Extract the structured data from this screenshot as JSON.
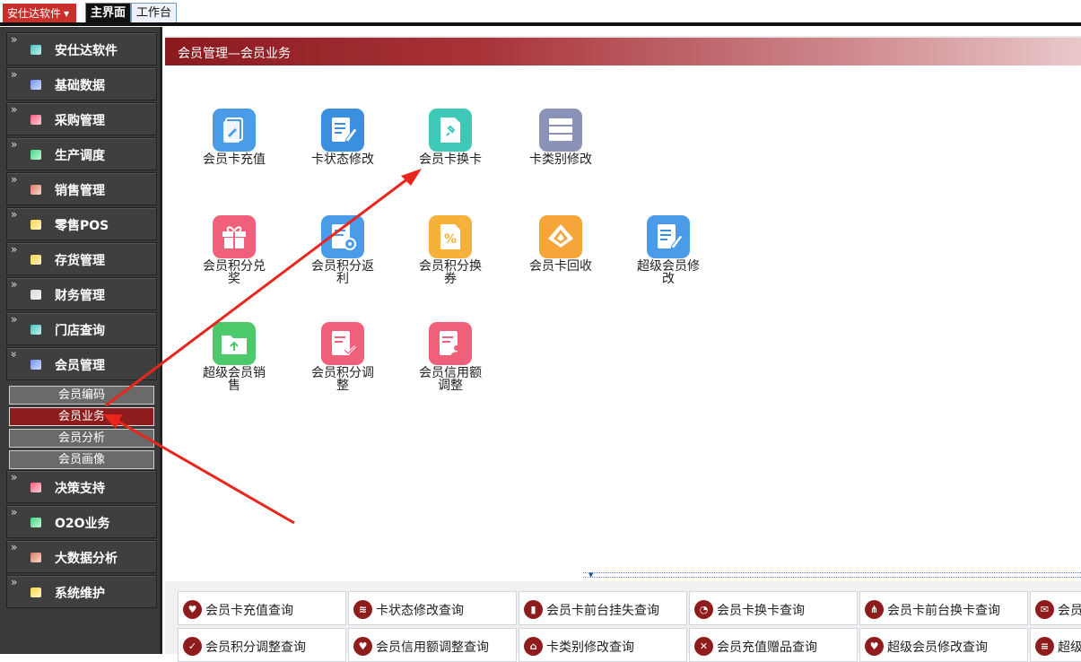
{
  "topbar": {
    "app_menu_label": "安仕达软件",
    "tabs": [
      "主界面",
      "工作台"
    ]
  },
  "sidebar": {
    "items": [
      {
        "label": "安仕达软件",
        "icon": "cube-icon",
        "color": "#3fc8c0"
      },
      {
        "label": "基础数据",
        "icon": "database-icon",
        "color": "#6f8cff"
      },
      {
        "label": "采购管理",
        "icon": "cart-icon",
        "color": "#ff5c7a"
      },
      {
        "label": "生产调度",
        "icon": "factory-icon",
        "color": "#43d67d"
      },
      {
        "label": "销售管理",
        "icon": "sales-icon",
        "color": "#e07a5f"
      },
      {
        "label": "零售POS",
        "icon": "pos-icon",
        "color": "#ffd84a"
      },
      {
        "label": "存货管理",
        "icon": "inventory-icon",
        "color": "#ffd34a"
      },
      {
        "label": "财务管理",
        "icon": "finance-icon",
        "color": "#d9d9d9"
      },
      {
        "label": "门店查询",
        "icon": "store-icon",
        "color": "#3fc8c0"
      },
      {
        "label": "会员管理",
        "icon": "member-icon",
        "color": "#6f8cff"
      },
      {
        "label": "决策支持",
        "icon": "decision-icon",
        "color": "#ff5c7a"
      },
      {
        "label": "O2O业务",
        "icon": "o2o-icon",
        "color": "#43d67d"
      },
      {
        "label": "大数据分析",
        "icon": "bigdata-icon",
        "color": "#e07a5f"
      },
      {
        "label": "系统维护",
        "icon": "settings-icon",
        "color": "#ffd84a"
      }
    ],
    "sub_items": [
      "会员编码",
      "会员业务",
      "会员分析",
      "会员画像"
    ]
  },
  "content": {
    "header_title": "会员管理—会员业务",
    "tiles": [
      {
        "label": "会员卡充值",
        "color": "#4a9be8",
        "icon": "card-recharge-icon"
      },
      {
        "label": "卡状态修改",
        "color": "#3b8fe0",
        "icon": "edit-doc-icon"
      },
      {
        "label": "会员卡换卡",
        "color": "#3dc8b8",
        "icon": "pin-card-icon"
      },
      {
        "label": "卡类别修改",
        "color": "#8a92b8",
        "icon": "server-icon"
      },
      {
        "label": "会员积分兑奖",
        "color": "#f0607a",
        "icon": "gift-icon"
      },
      {
        "label": "会员积分返利",
        "color": "#4a9be8",
        "icon": "doc-gear-icon"
      },
      {
        "label": "会员积分换券",
        "color": "#f6b13a",
        "icon": "coupon-icon"
      },
      {
        "label": "会员卡回收",
        "color": "#f6a53a",
        "icon": "recycle-icon"
      },
      {
        "label": "超级会员修改",
        "color": "#4a9be8",
        "icon": "edit-doc-icon"
      },
      {
        "label": "超级会员销售",
        "color": "#4cc96a",
        "icon": "folder-upload-icon"
      },
      {
        "label": "会员积分调整",
        "color": "#f0607a",
        "icon": "doc-check-icon"
      },
      {
        "label": "会员信用额调整",
        "color": "#f0607a",
        "icon": "doc-user-icon"
      }
    ]
  },
  "bottom_links": [
    [
      "会员卡充值查询",
      "卡状态修改查询",
      "会员卡前台挂失查询",
      "会员卡换卡查询",
      "会员卡前台换卡查询",
      "会员"
    ],
    [
      "会员积分调整查询",
      "会员信用额调整查询",
      "卡类别修改查询",
      "会员充值赠品查询",
      "超级会员修改查询",
      "超级"
    ]
  ],
  "bottom_link_icons": [
    [
      "heart-icon",
      "layers-icon",
      "bar-chart-icon",
      "pie-icon",
      "share-icon",
      "chat-icon"
    ],
    [
      "check-icon",
      "heart-icon",
      "tag-icon",
      "x-icon",
      "heart-icon",
      "db-icon"
    ]
  ]
}
